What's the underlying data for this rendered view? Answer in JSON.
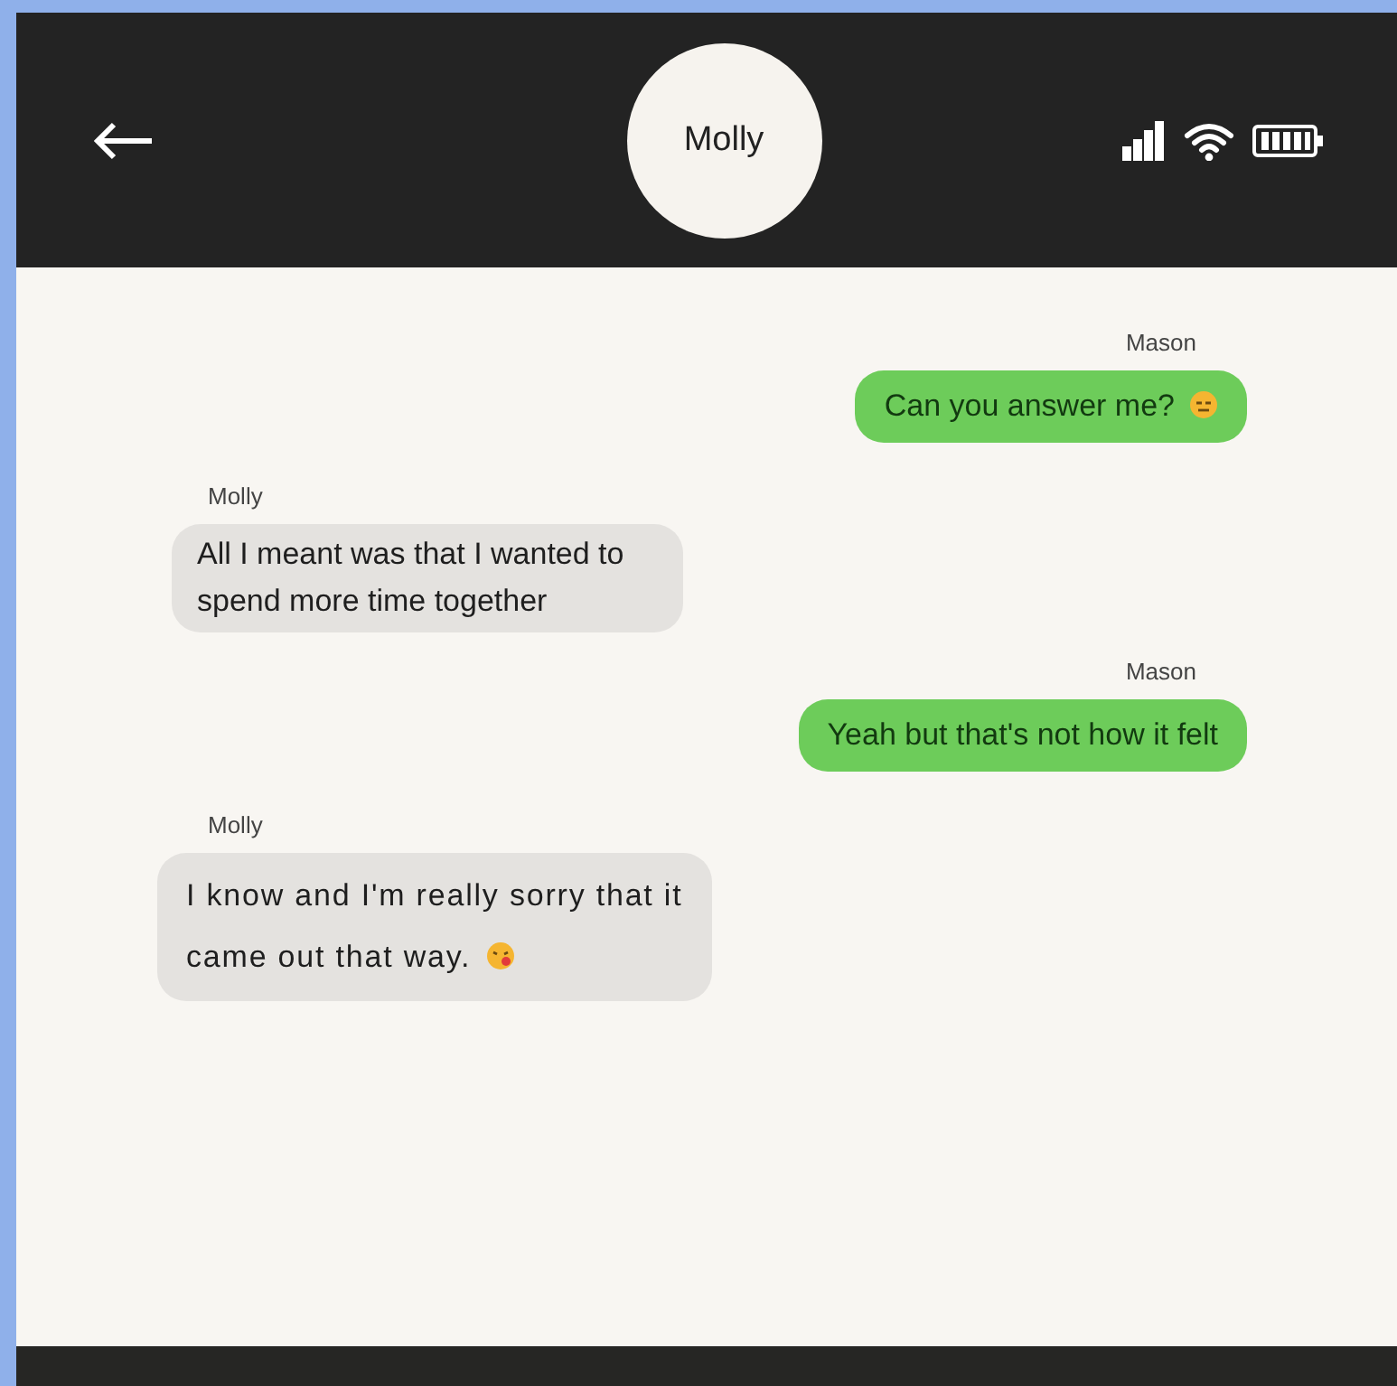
{
  "header": {
    "contact": "Molly"
  },
  "messages": [
    {
      "kind": "sent",
      "sender": "Mason",
      "text": "Can you answer me?",
      "emoji": true
    },
    {
      "kind": "received",
      "sender": "Molly",
      "text": "All I meant was that I wanted to spend more time together",
      "emoji": false
    },
    {
      "kind": "sent",
      "sender": "Mason",
      "text": "Yeah but that's not how it felt",
      "emoji": false
    },
    {
      "kind": "received",
      "sender": "Molly",
      "text": "I know and I'm really sorry that it came out that way.",
      "emoji": true
    }
  ]
}
